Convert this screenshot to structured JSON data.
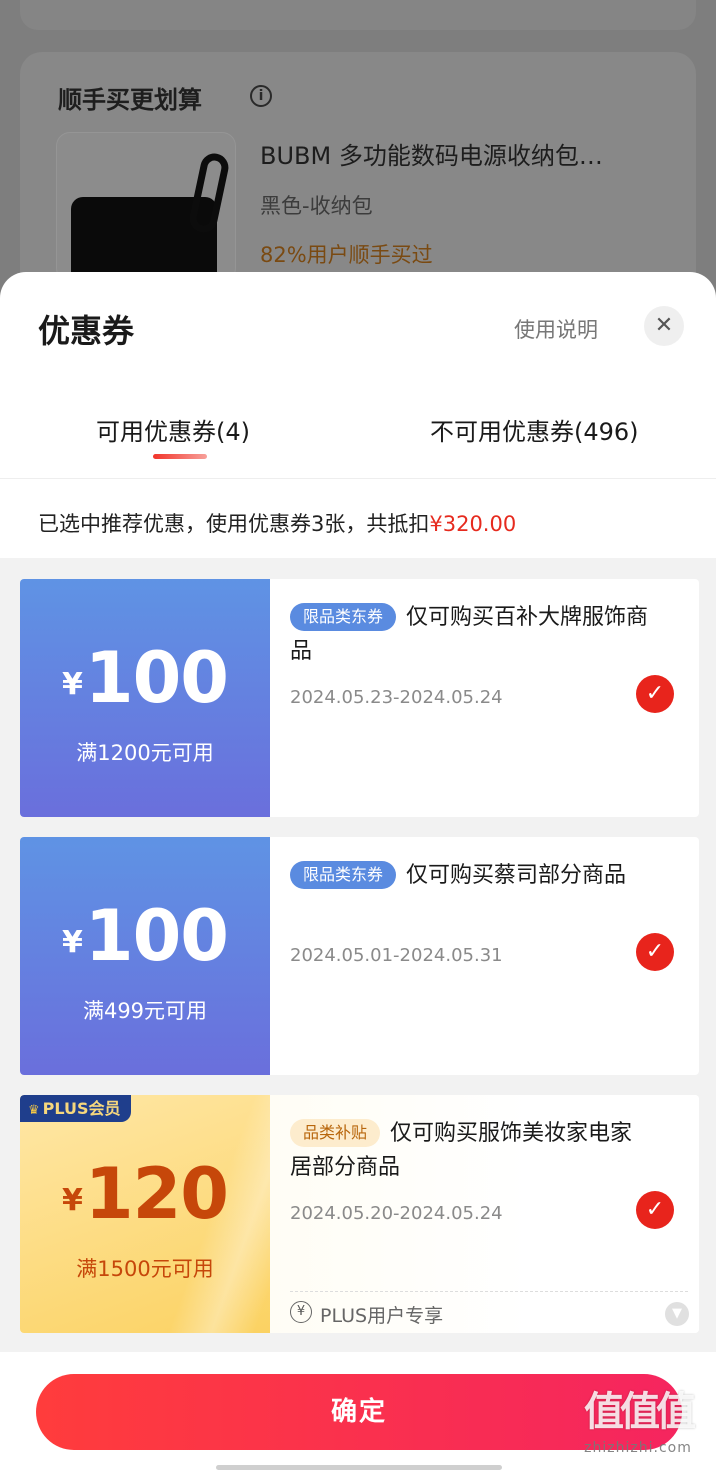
{
  "background": {
    "section_title": "顺手买更划算",
    "info_icon": "info-icon",
    "product": {
      "title": "BUBM 多功能数码电源收纳包…",
      "variant": "黑色-收纳包",
      "hint": "82%用户顺手买过"
    }
  },
  "sheet": {
    "title": "优惠券",
    "usage_link": "使用说明",
    "close_icon": "close-icon",
    "close_glyph": "✕",
    "tabs": [
      {
        "label": "可用优惠券(4)",
        "active": true
      },
      {
        "label": "不可用优惠券(496)",
        "active": false
      }
    ],
    "summary_prefix": "已选中推荐优惠，使用优惠券3张，共抵扣",
    "summary_amount": "¥320.00"
  },
  "coupons": [
    {
      "currency": "¥",
      "amount": "100",
      "condition": "满1200元可用",
      "tag": "限品类东券",
      "description": "仅可购买百补大牌服饰商品",
      "dates": "2024.05.23-2024.05.24",
      "selected": true,
      "check_glyph": "✓"
    },
    {
      "currency": "¥",
      "amount": "100",
      "condition": "满499元可用",
      "tag": "限品类东券",
      "description": "仅可购买蔡司部分商品",
      "dates": "2024.05.01-2024.05.31",
      "selected": true,
      "check_glyph": "✓"
    },
    {
      "badge": "PLUS会员",
      "badge_icon": "crown-icon",
      "currency": "¥",
      "amount": "120",
      "condition": "满1500元可用",
      "tag": "品类补贴",
      "description": "仅可购买服饰美妆家电家居部分商品",
      "dates": "2024.05.20-2024.05.24",
      "selected": true,
      "check_glyph": "✓",
      "exclusive_icon_glyph": "¥",
      "exclusive_note": "PLUS用户专享",
      "expand_icon": "chevron-down-icon"
    }
  ],
  "footer": {
    "confirm_label": "确定"
  },
  "watermark": {
    "main": "值值值",
    "sub": "zhizhizhi.com"
  },
  "colors": {
    "accent_red": "#e8241c",
    "coupon_blue": "#5f93e4",
    "coupon_gold": "#fbd262",
    "amount_orange": "#c6470a"
  }
}
